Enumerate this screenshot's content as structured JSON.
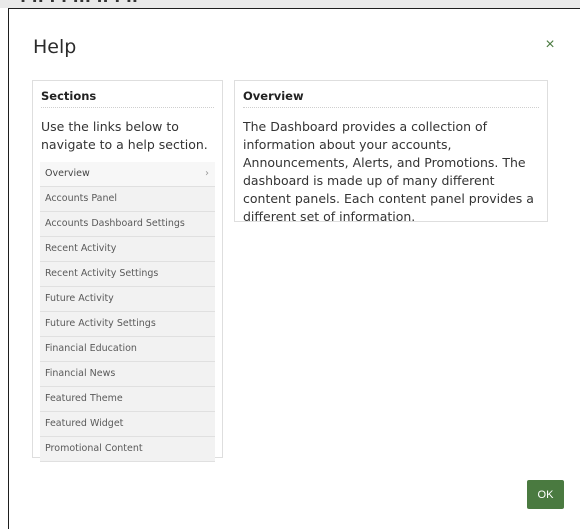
{
  "background": {
    "partial_text": "· ·· · · ··· ·· · ··"
  },
  "dialog": {
    "title": "Help",
    "close_glyph": "×",
    "ok_label": "OK"
  },
  "sections": {
    "heading": "Sections",
    "intro": "Use the links below to navigate to a help section.",
    "items": [
      {
        "label": "Overview",
        "active": true
      },
      {
        "label": "Accounts Panel"
      },
      {
        "label": "Accounts Dashboard Settings"
      },
      {
        "label": "Recent Activity"
      },
      {
        "label": "Recent Activity Settings"
      },
      {
        "label": "Future Activity"
      },
      {
        "label": "Future Activity Settings"
      },
      {
        "label": "Financial Education"
      },
      {
        "label": "Financial News"
      },
      {
        "label": "Featured Theme"
      },
      {
        "label": "Featured Widget"
      },
      {
        "label": "Promotional Content"
      }
    ],
    "chevron_glyph": "›"
  },
  "overview": {
    "heading": "Overview",
    "body": "The Dashboard provides a collection of information about your accounts, Announcements, Alerts, and Promotions. The dashboard is made up of many different content panels. Each content panel provides a different set of information."
  },
  "colors": {
    "accent": "#4a7a40",
    "panel_border": "#dedede",
    "list_bg": "#f2f2f2"
  }
}
